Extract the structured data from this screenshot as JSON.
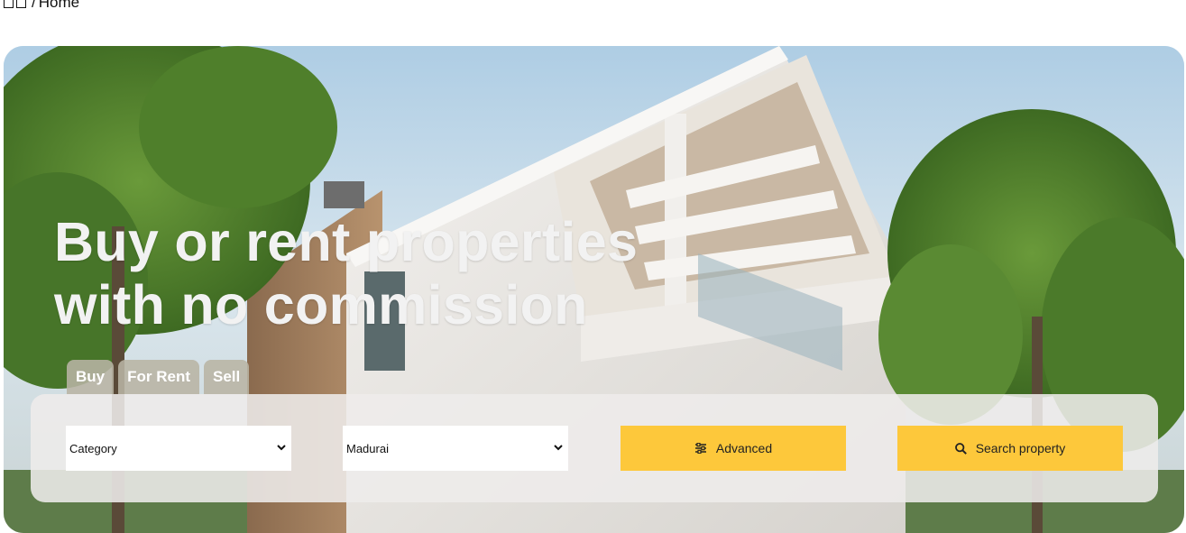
{
  "breadcrumb": {
    "separator": "/",
    "current": "Home"
  },
  "hero": {
    "title_line1": "Buy or rent properties",
    "title_line2": "with no commission"
  },
  "tabs": [
    {
      "label": "Buy"
    },
    {
      "label": "For Rent"
    },
    {
      "label": "Sell"
    }
  ],
  "search": {
    "category_value": "Category",
    "location_value": "Madurai",
    "advanced_label": "Advanced",
    "search_label": "Search property",
    "advanced_icon": "sliders-icon",
    "search_icon": "search-icon"
  },
  "colors": {
    "accent": "#fdc83b",
    "tab_bg": "#b8b4a4",
    "panel_bg": "#eeecea"
  }
}
